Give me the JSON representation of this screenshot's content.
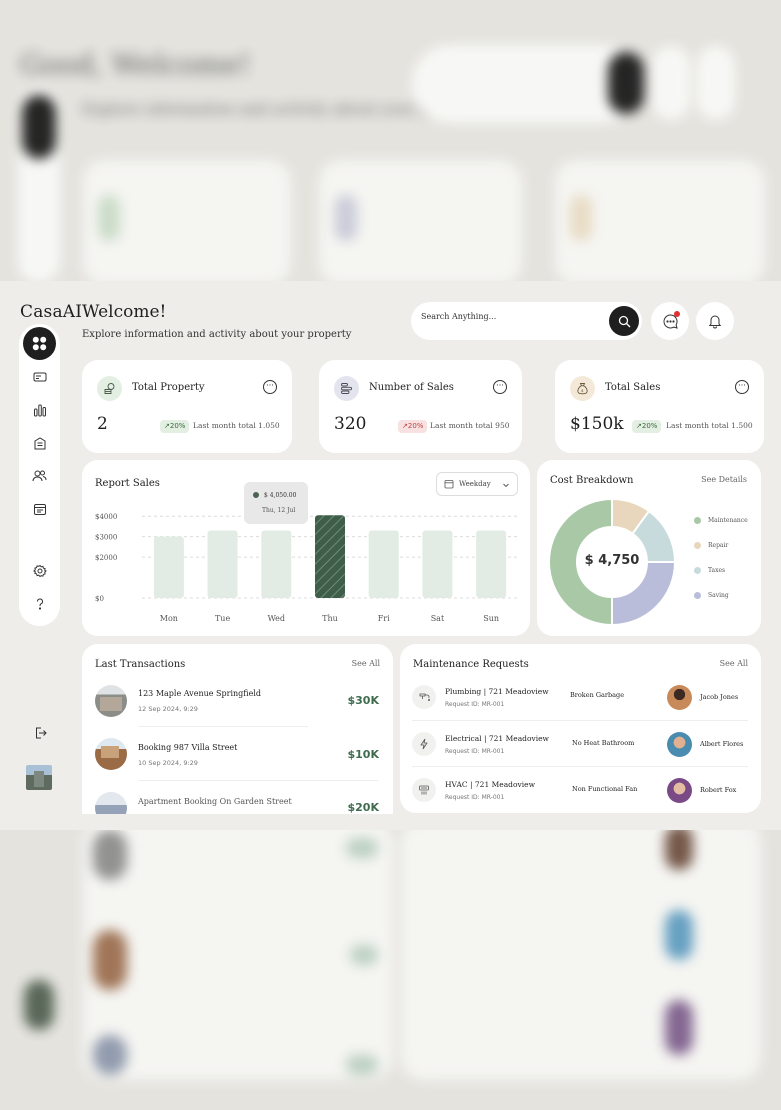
{
  "app": {
    "logo": "CasaAI"
  },
  "header": {
    "title": "Welcome!",
    "subtitle": "Explore information and activity about your property",
    "search_placeholder": "Search Anything...",
    "bg_title": "Good, Welcome!",
    "bg_subtitle": "Explore information and activity about your property",
    "bg_search": "Search Anything..."
  },
  "sidebar": {
    "items": [
      {
        "name": "dashboard",
        "icon": "grid-icon",
        "active": true
      },
      {
        "name": "cards",
        "icon": "card-icon",
        "active": false
      },
      {
        "name": "analytics",
        "icon": "bar-chart-icon",
        "active": false
      },
      {
        "name": "buildings",
        "icon": "building-icon",
        "active": false
      },
      {
        "name": "users",
        "icon": "users-icon",
        "active": false
      },
      {
        "name": "calendar",
        "icon": "calendar-icon",
        "active": false
      },
      {
        "name": "settings",
        "icon": "gear-icon",
        "active": false
      },
      {
        "name": "help",
        "icon": "help-icon",
        "active": false
      }
    ],
    "logout_icon": "logout-icon"
  },
  "stats": [
    {
      "title": "Total Property",
      "value": "2",
      "change": "20%",
      "direction": "up",
      "note": "Last month total 1.050",
      "icon": "coins-icon",
      "icon_bg": "#e3efe2"
    },
    {
      "title": "Number of Sales",
      "value": "320",
      "change": "20%",
      "direction": "down",
      "note": "Last month total 950",
      "icon": "list-icon",
      "icon_bg": "#e4e4ee"
    },
    {
      "title": "Total Sales",
      "value": "$150k",
      "change": "20%",
      "direction": "up",
      "note": "Last month total 1.500",
      "icon": "money-bag-icon",
      "icon_bg": "#f4e9d8"
    }
  ],
  "report": {
    "title": "Report Sales",
    "select_value": "Weekday",
    "tooltip_value": "$ 4,050.00",
    "tooltip_date": "Thu, 12 Jul"
  },
  "chart_data": [
    {
      "type": "bar",
      "title": "Report Sales",
      "categories": [
        "Mon",
        "Tue",
        "Wed",
        "Thu",
        "Fri",
        "Sat",
        "Sun"
      ],
      "values": [
        3000,
        3300,
        3300,
        4050,
        3300,
        3300,
        3300
      ],
      "highlighted": "Thu",
      "yticks": [
        "$4000",
        "$3000",
        "$2000",
        "$0"
      ],
      "ytick_values": [
        4000,
        3000,
        2000,
        0
      ],
      "ylim": [
        0,
        4500
      ],
      "grid": true
    },
    {
      "type": "pie",
      "title": "Cost Breakdown",
      "center_label": "$ 4,750",
      "categories": [
        "Maintenance",
        "Repair",
        "Taxes",
        "Saving"
      ],
      "values": [
        50,
        10,
        15,
        25
      ],
      "colors": [
        "#a8c8a6",
        "#e8d7bc",
        "#c7dbdd",
        "#babdd9"
      ],
      "legend": "right"
    }
  ],
  "cost": {
    "title": "Cost Breakdown",
    "see_label": "See Details"
  },
  "transactions": {
    "title": "Last Transactions",
    "see_label": "See All",
    "items": [
      {
        "name": "123 Maple Avenue Springfield",
        "date": "12 Sep 2024, 9:29",
        "amount": "$30K"
      },
      {
        "name": "Booking 987 Villa Street",
        "date": "10 Sep 2024, 9:29",
        "amount": "$10K"
      },
      {
        "name": "Apartment Booking On Garden Street",
        "date": "",
        "amount": "$20K"
      }
    ]
  },
  "maintenance": {
    "title": "Maintenance Requests",
    "see_label": "See All",
    "items": [
      {
        "title": "Plumbing | 721 Meadoview",
        "request_id": "Request ID: MR-001",
        "issue": "Broken Garbage",
        "person": "Jacob Jones",
        "icon": "faucet-icon",
        "avatar_color": "#c98a5a"
      },
      {
        "title": "Electrical | 721 Meadoview",
        "request_id": "Request ID: MR-001",
        "issue": "No Heat Bathroom",
        "person": "Albert Flores",
        "icon": "bolt-icon",
        "avatar_color": "#4a8bb0"
      },
      {
        "title": "HVAC | 721 Meadoview",
        "request_id": "Request ID: MR-001",
        "issue": "Non Functional Fan",
        "person": "Robert Fox",
        "icon": "hvac-icon",
        "avatar_color": "#7a4a86"
      }
    ]
  }
}
